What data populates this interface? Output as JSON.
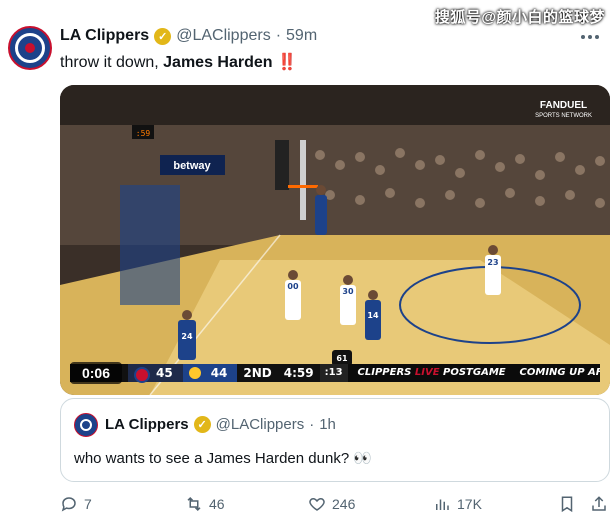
{
  "watermark": "搜狐号@颜小白的篮球梦",
  "tweet": {
    "author_name": "LA Clippers",
    "handle": "@LAClippers",
    "separator": "·",
    "time": "59m",
    "text_plain": "throw it down, ",
    "text_bold": "James Harden",
    "text_emoji": "‼️"
  },
  "media": {
    "network_logo": "FANDUEL",
    "network_sub": "SPORTS NETWORK",
    "shot_clock_display": ":59",
    "court_text": "betway",
    "video_time": "0:06",
    "scoreboard": {
      "team1_score": "45",
      "team2_score": "44",
      "quarter": "2ND",
      "clock": "4:59",
      "shot_clock": ":13",
      "ad_clippers": "CLIPPERS",
      "ad_live": "LIVE",
      "ad_postgame": "POSTGAME",
      "ad_coming": "COMING UP AFTER THE GAME"
    },
    "jersey_numbers": [
      "24",
      "00",
      "30",
      "14",
      "23",
      "61"
    ]
  },
  "quote": {
    "author_name": "LA Clippers",
    "handle": "@LAClippers",
    "separator": "·",
    "time": "1h",
    "text": "who wants to see a James Harden dunk? 👀"
  },
  "actions": {
    "replies": "7",
    "reposts": "46",
    "likes": "246",
    "views": "17K"
  },
  "colors": {
    "clippers_blue": "#1d428a",
    "clippers_red": "#c8102e",
    "verified_gold": "#e2b719",
    "muted": "#536471"
  }
}
